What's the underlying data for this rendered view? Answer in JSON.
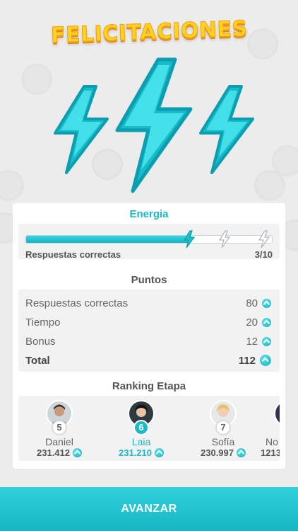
{
  "header": {
    "title": "FELICITACIONES"
  },
  "energy": {
    "title": "Energia",
    "label": "Respuestas correctas",
    "count": "3/10",
    "progress": 0.67
  },
  "points": {
    "title": "Puntos",
    "rows": [
      {
        "label": "Respuestas correctas",
        "value": "80"
      },
      {
        "label": "Tiempo",
        "value": "20"
      },
      {
        "label": "Bonus",
        "value": "12"
      }
    ],
    "total": {
      "label": "Total",
      "value": "112"
    }
  },
  "ranking": {
    "title": "Ranking Etapa",
    "players": [
      {
        "position": "5",
        "name": "Daniel",
        "score": "231.412",
        "is_me": false
      },
      {
        "position": "6",
        "name": "Laia",
        "score": "231.210",
        "is_me": true
      },
      {
        "position": "7",
        "name": "Sofía",
        "score": "230.997",
        "is_me": false
      },
      {
        "position": "",
        "name": "No",
        "score": "1213",
        "is_me": false
      }
    ]
  },
  "footer": {
    "advance_label": "AVANZAR"
  },
  "colors": {
    "accent": "#1bb7c4",
    "title_yellow": "#ffd21f",
    "background": "#ececec"
  },
  "icons": [
    "lightning-bolt-icon",
    "coin-arrow-icon"
  ]
}
